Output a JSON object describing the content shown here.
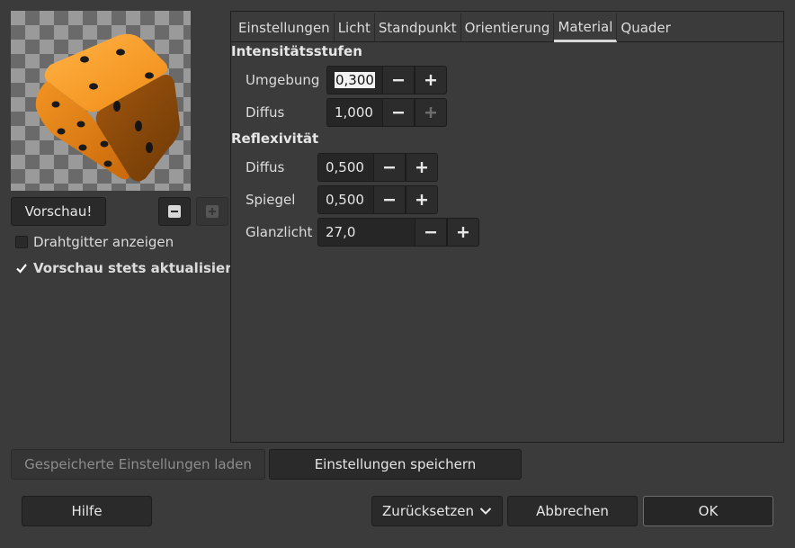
{
  "left": {
    "preview_button": "Vorschau!",
    "zoom_out_icon": "zoom-out-icon",
    "zoom_in_icon": "zoom-in-icon",
    "wireframe": {
      "label": "Drahtgitter anzeigen",
      "checked": false
    },
    "always_update": {
      "label": "Vorschau stets aktualisieren",
      "checked": true
    }
  },
  "tabs": [
    {
      "label": "Einstellungen",
      "active": false
    },
    {
      "label": "Licht",
      "active": false
    },
    {
      "label": "Standpunkt",
      "active": false
    },
    {
      "label": "Orientierung",
      "active": false
    },
    {
      "label": "Material",
      "active": true
    },
    {
      "label": "Quader",
      "active": false
    }
  ],
  "material": {
    "intensity_title": "Intensitätsstufen",
    "ambient": {
      "label": "Umgebung",
      "value": "0,300"
    },
    "diffuse_int": {
      "label": "Diffus",
      "value": "1,000"
    },
    "reflex_title": "Reflexivität",
    "diffuse_ref": {
      "label": "Diffus",
      "value": "0,500"
    },
    "specular": {
      "label": "Spiegel",
      "value": "0,500"
    },
    "highlight": {
      "label": "Glanzlicht",
      "value": "27,0"
    }
  },
  "actions": {
    "load": "Gespeicherte Einstellungen laden",
    "save": "Einstellungen speichern",
    "help": "Hilfe",
    "reset": "Zurücksetzen",
    "cancel": "Abbrechen",
    "ok": "OK"
  },
  "colors": {
    "dice": "#f0901c",
    "dots": "#1a1a1a",
    "bg": "#3b3b3b"
  }
}
